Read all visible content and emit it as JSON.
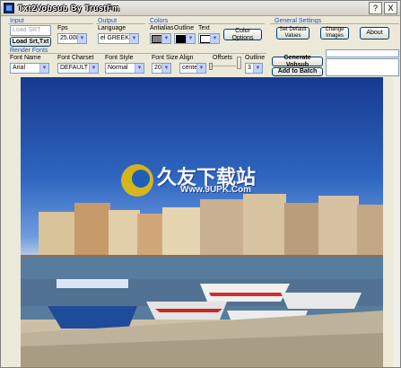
{
  "window": {
    "title": "Txt2Vobsub By TrustFm",
    "help_btn": "?",
    "close_btn": "X"
  },
  "input": {
    "group": "Input",
    "srt_placeholder": "Load SRT",
    "load_btn": "Load Srt,Txt",
    "fps_label": "Fps",
    "fps_value": "25.000"
  },
  "output": {
    "group": "Output",
    "language_label": "Language",
    "language_value": "el GREEK"
  },
  "colors": {
    "group": "Colors",
    "antialias_label": "Antialias",
    "outline_label": "Outline",
    "text_label": "Text",
    "options_btn": "Color Options",
    "antialias_color": "#808080",
    "outline_color": "#000000",
    "text_color": "#ffffff"
  },
  "general": {
    "group": "General Settings",
    "default_btn": "Set Default\nValues",
    "change_images_btn": "Change\nImages",
    "about_btn": "About"
  },
  "render": {
    "group": "Render Fonts",
    "font_name_label": "Font Name",
    "font_name_value": "Arial",
    "charset_label": "Font Charset",
    "charset_value": "DEFAULT",
    "style_label": "Font Style",
    "style_value": "Normal",
    "size_label": "Font Size",
    "size_value": "20",
    "align_label": "Align",
    "align_value": "center",
    "offsets_label": "Offsets",
    "outline_label": "Outline",
    "outline_value": "3",
    "generate_btn": "Generate Vobsub",
    "batch_btn": "Add to Batch"
  },
  "preview": {
    "watermark_cn": "久友下载站",
    "watermark_url": "Www.9UPK.Com"
  }
}
